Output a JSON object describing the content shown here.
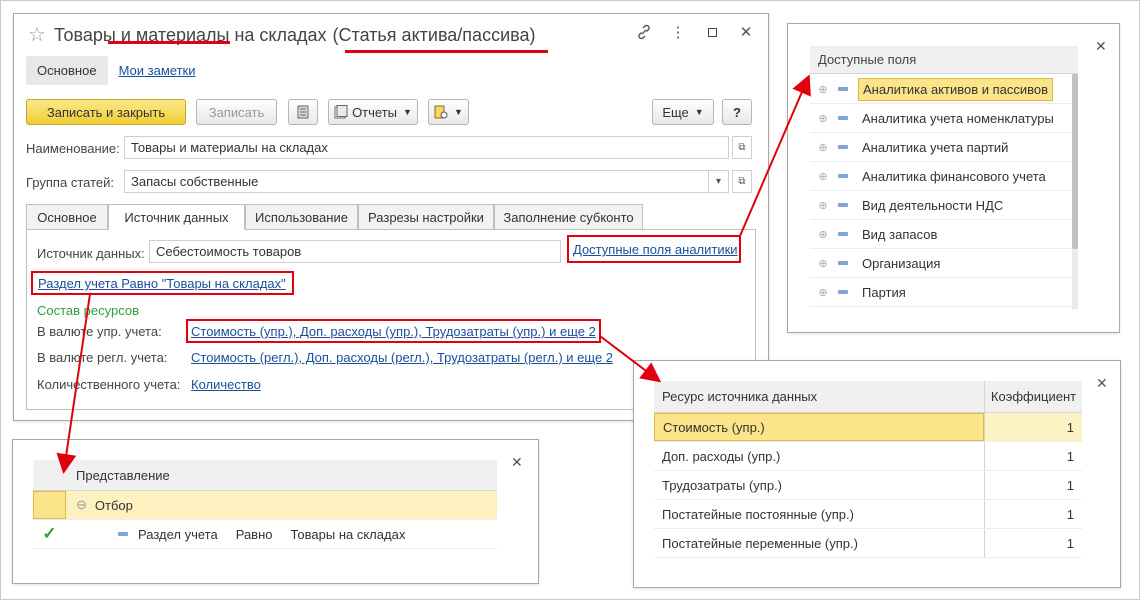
{
  "main": {
    "title": "Товары и материалы на складах",
    "title_highlight": "(Статья актива/пассива)",
    "top_tabs": [
      "Основное",
      "Мои заметки"
    ],
    "toolbar": {
      "save_close": "Записать и закрыть",
      "save": "Записать",
      "reports": "Отчеты",
      "more": "Еще",
      "help": "?"
    },
    "fields": {
      "name_label": "Наименование:",
      "name_value": "Товары и материалы на складах",
      "group_label": "Группа статей:",
      "group_value": "Запасы собственные"
    },
    "tabs": [
      "Основное",
      "Источник данных",
      "Использование",
      "Разрезы настройки",
      "Заполнение субконто"
    ],
    "source": {
      "label": "Источник данных:",
      "value": "Себестоимость товаров",
      "fields_link": "Доступные поля аналитики",
      "filter_link": "Раздел учета Равно \"Товары на складах\"",
      "resources_title": "Состав ресурсов",
      "mgmt_label": "В валюте упр. учета:",
      "mgmt_value": "Стоимость (упр.), Доп. расходы (упр.), Трудозатраты (упр.) и еще 2",
      "reg_label": "В валюте регл. учета:",
      "reg_value": "Стоимость (регл.), Доп. расходы (регл.), Трудозатраты (регл.) и еще 2",
      "qty_label": "Количественного учета:",
      "qty_value": "Количество"
    }
  },
  "fields_panel": {
    "header": "Доступные поля",
    "items": [
      "Аналитика активов и пассивов",
      "Аналитика учета номенклатуры",
      "Аналитика учета партий",
      "Аналитика финансового учета",
      "Вид деятельности НДС",
      "Вид запасов",
      "Организация",
      "Партия"
    ]
  },
  "resources_panel": {
    "col1": "Ресурс источника данных",
    "col2": "Коэффициент",
    "rows": [
      {
        "name": "Стоимость (упр.)",
        "coef": "1"
      },
      {
        "name": "Доп. расходы (упр.)",
        "coef": "1"
      },
      {
        "name": "Трудозатраты (упр.)",
        "coef": "1"
      },
      {
        "name": "Постатейные постоянные (упр.)",
        "coef": "1"
      },
      {
        "name": "Постатейные переменные (упр.)",
        "coef": "1"
      }
    ]
  },
  "filter_panel": {
    "header": "Представление",
    "group": "Отбор",
    "item_field": "Раздел учета",
    "item_cond": "Равно",
    "item_value": "Товары на складах"
  },
  "colors": {
    "accent_red": "#e0000e",
    "selection": "#fbe48a",
    "link": "#1a4f9c"
  }
}
